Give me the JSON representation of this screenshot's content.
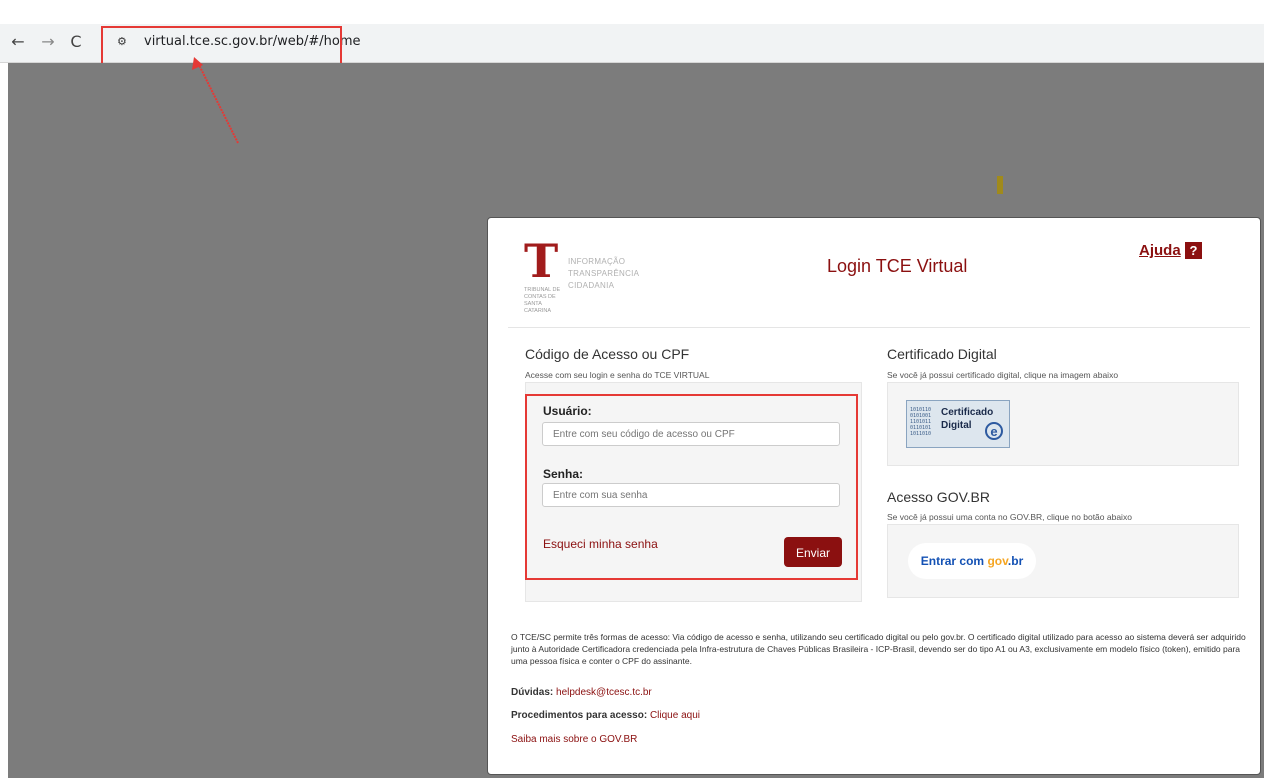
{
  "browser": {
    "back_icon": "←",
    "forward_icon": "→",
    "reload_icon": "C",
    "site_info_icon": "⚙",
    "url": "virtual.tce.sc.gov.br/web/#/home"
  },
  "logo": {
    "line1": "INFORMAÇÃO",
    "line2": "TRANSPARÊNCIA",
    "line3": "CIDADANIA",
    "sub": "TRIBUNAL DE CONTAS DE SANTA CATARINA"
  },
  "header": {
    "title": "Login TCE Virtual",
    "help_label": "Ajuda",
    "help_icon": "?"
  },
  "login": {
    "section_title": "Código de Acesso ou CPF",
    "section_desc": "Acesse com seu login e senha do TCE VIRTUAL",
    "user_label": "Usuário:",
    "user_placeholder": "Entre com seu código de acesso ou CPF",
    "password_label": "Senha:",
    "password_placeholder": "Entre com sua senha",
    "forgot_label": "Esqueci minha senha",
    "submit_label": "Enviar"
  },
  "certificate": {
    "section_title": "Certificado Digital",
    "section_desc": "Se você já possui certificado digital, clique na imagem abaixo",
    "button_line1": "Certificado",
    "button_line2": "Digital",
    "button_mark": "e"
  },
  "govbr": {
    "section_title": "Acesso GOV.BR",
    "section_desc": "Se você já possui uma conta no GOV.BR, clique no botão abaixo",
    "button_label": "Entrar com",
    "button_logo_a": "gov",
    "button_logo_b": ".br"
  },
  "footer": {
    "info": "O TCE/SC permite três formas de acesso: Via código de acesso e senha, utilizando seu certificado digital ou pelo gov.br. O certificado digital utilizado para acesso ao sistema deverá ser adquirido junto à Autoridade Certificadora credenciada pela Infra-estrutura de Chaves Públicas Brasileira - ICP-Brasil, devendo ser do tipo A1 ou A3, exclusivamente em modelo físico (token), emitido para uma pessoa física e conter o CPF do assinante.",
    "doubts_label": "Dúvidas:",
    "doubts_email": "helpdesk@tcesc.tc.br",
    "procedures_label": "Procedimentos para acesso:",
    "procedures_link": "Clique aqui",
    "govbr_link": "Saiba mais sobre o GOV.BR"
  }
}
